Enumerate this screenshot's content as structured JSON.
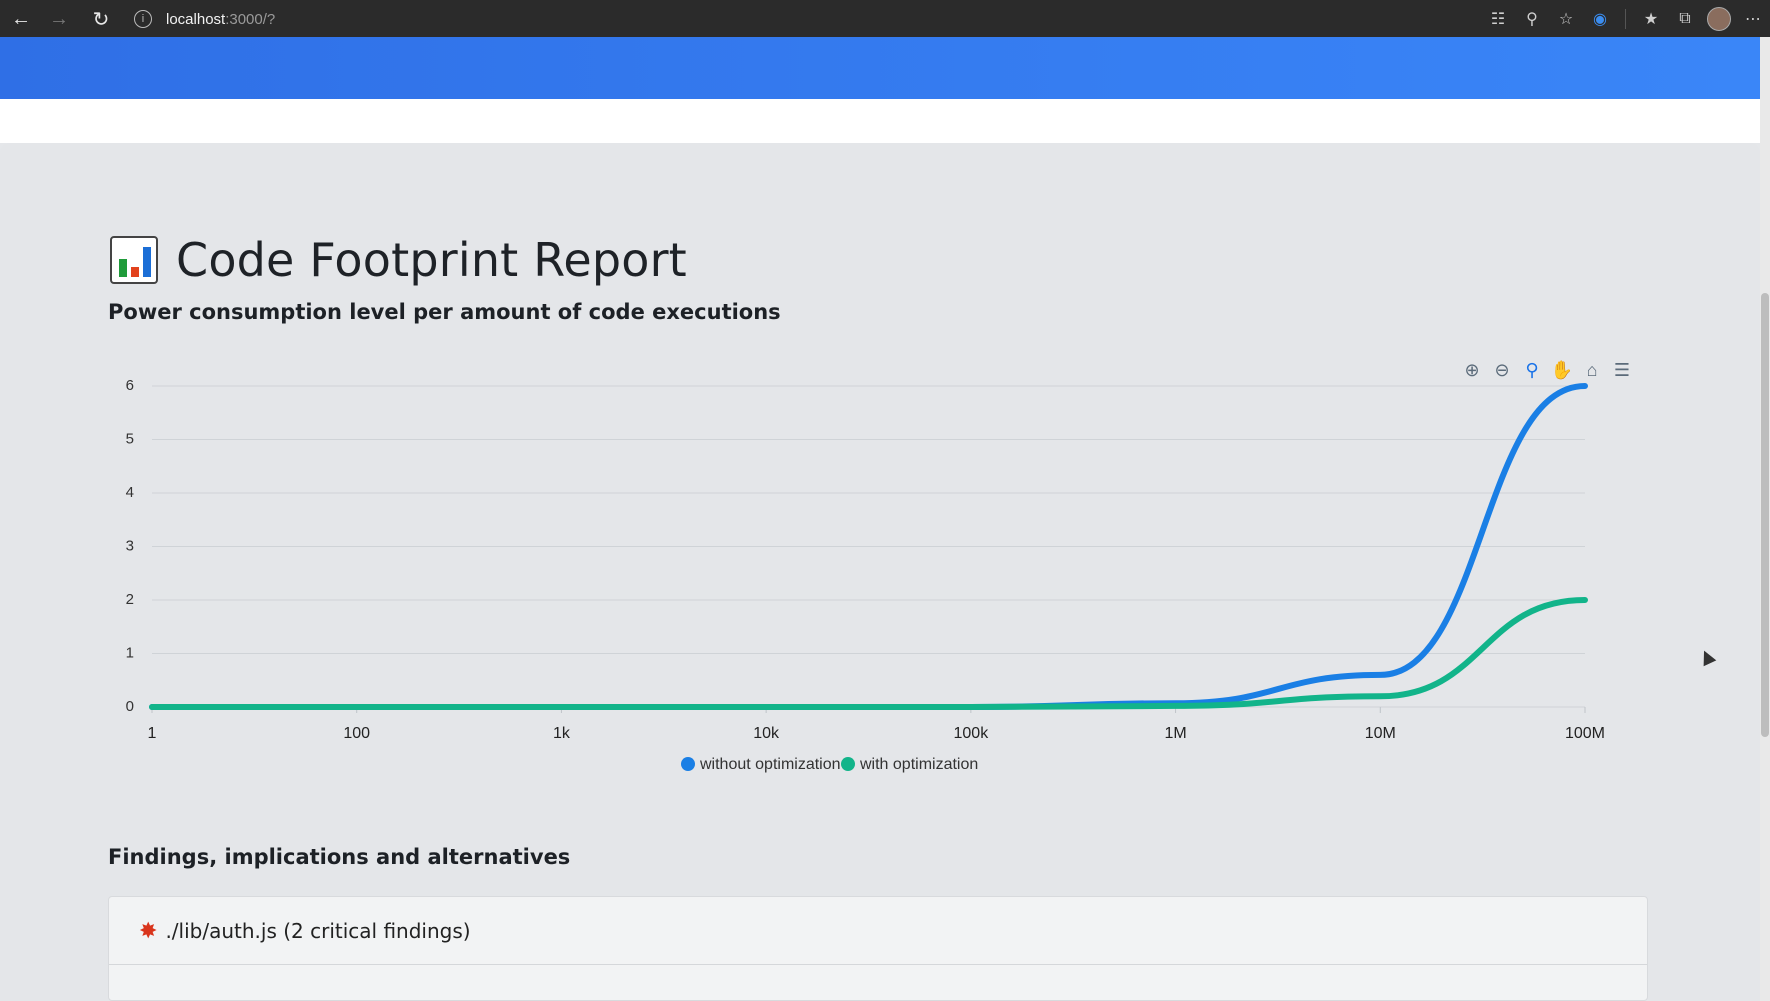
{
  "browser": {
    "url_host": "localhost",
    "url_rest": ":3000/?"
  },
  "page": {
    "title": "Code Footprint Report",
    "subtitle": "Power consumption level per amount of code executions",
    "findings_heading": "Findings, implications and alternatives",
    "finding_item": "./lib/auth.js (2 critical findings)"
  },
  "chart_data": {
    "type": "line",
    "title": "",
    "xlabel": "",
    "ylabel": "",
    "x": [
      "1",
      "100",
      "1k",
      "10k",
      "100k",
      "1M",
      "10M",
      "100M"
    ],
    "x_scale": "log",
    "ylim": [
      0,
      6
    ],
    "yticks": [
      0,
      1,
      2,
      3,
      4,
      5,
      6
    ],
    "grid": true,
    "legend": "bottom-center",
    "series": [
      {
        "name": "without optimization",
        "color": "#1a7fe5",
        "values": [
          0,
          0,
          0,
          0,
          0,
          0.07,
          0.6,
          6
        ]
      },
      {
        "name": "with optimization",
        "color": "#12b48a",
        "values": [
          0,
          0,
          0,
          0,
          0,
          0.02,
          0.2,
          2
        ]
      }
    ]
  }
}
